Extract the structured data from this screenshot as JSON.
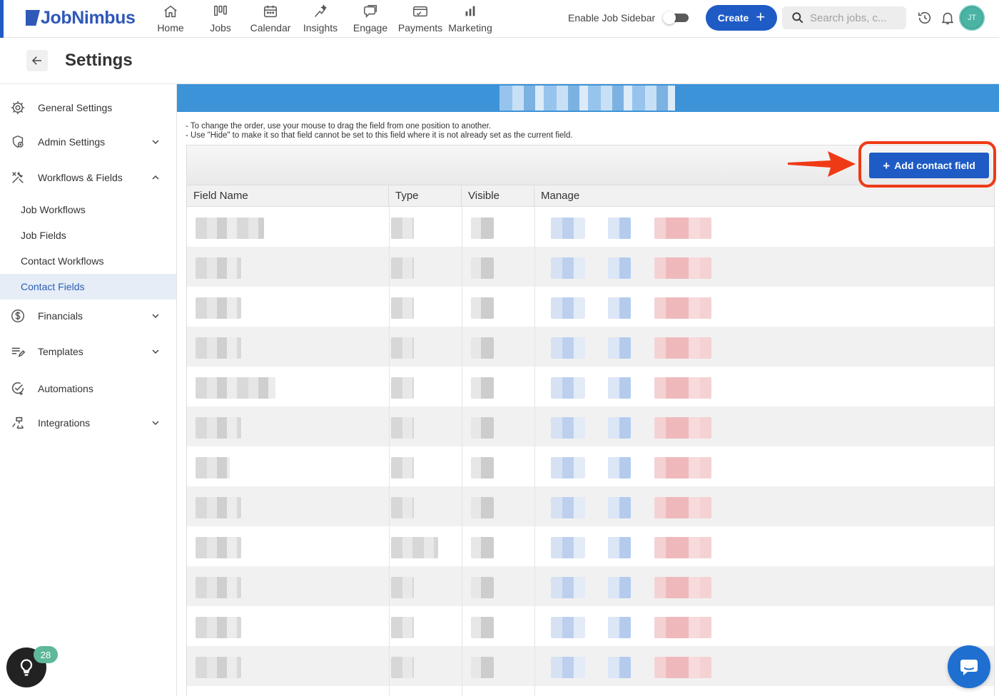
{
  "app": {
    "logo_text": "JobNimbus"
  },
  "nav": {
    "items": [
      {
        "id": "home",
        "label": "Home",
        "icon": "home-icon"
      },
      {
        "id": "jobs",
        "label": "Jobs",
        "icon": "jobs-icon"
      },
      {
        "id": "calendar",
        "label": "Calendar",
        "icon": "calendar-icon"
      },
      {
        "id": "insights",
        "label": "Insights",
        "icon": "insights-icon"
      },
      {
        "id": "engage",
        "label": "Engage",
        "icon": "engage-icon"
      },
      {
        "id": "payments",
        "label": "Payments",
        "icon": "payments-icon"
      },
      {
        "id": "marketing",
        "label": "Marketing",
        "icon": "marketing-icon"
      }
    ],
    "job_sidebar_label": "Enable Job Sidebar",
    "job_sidebar_enabled": false,
    "create_label": "Create",
    "search_placeholder": "Search jobs, c...",
    "avatar_initials": "JT"
  },
  "settings": {
    "title": "Settings"
  },
  "sidebar": {
    "items": [
      {
        "label": "General Settings",
        "icon": "gear-icon",
        "expandable": false
      },
      {
        "label": "Admin Settings",
        "icon": "admin-shield-icon",
        "expandable": true,
        "expanded": false
      },
      {
        "label": "Workflows & Fields",
        "icon": "tools-icon",
        "expandable": true,
        "expanded": true
      },
      {
        "label": "Financials",
        "icon": "dollar-icon",
        "expandable": true,
        "expanded": false
      },
      {
        "label": "Templates",
        "icon": "templates-icon",
        "expandable": true,
        "expanded": false
      },
      {
        "label": "Automations",
        "icon": "automation-icon",
        "expandable": false
      },
      {
        "label": "Integrations",
        "icon": "integrations-icon",
        "expandable": true,
        "expanded": false
      }
    ],
    "sub_items": [
      {
        "label": "Job Workflows",
        "active": false
      },
      {
        "label": "Job Fields",
        "active": false
      },
      {
        "label": "Contact Workflows",
        "active": false
      },
      {
        "label": "Contact Fields",
        "active": true
      }
    ]
  },
  "main": {
    "instructions": [
      "- To change the order, use your mouse to drag the field from one position to another.",
      "- Use \"Hide\" to make it so that field cannot be set to this field where it is not already set as the current field."
    ],
    "add_button_label": "Add contact field",
    "columns": [
      "Field Name",
      "Type",
      "Visible",
      "Manage"
    ]
  },
  "floating": {
    "tips_badge_count": "28"
  },
  "colors": {
    "brand": "#1f5bc4",
    "banner": "#3c93d8",
    "highlight": "#f03a16",
    "active_nav_bg": "#e6edf7"
  }
}
